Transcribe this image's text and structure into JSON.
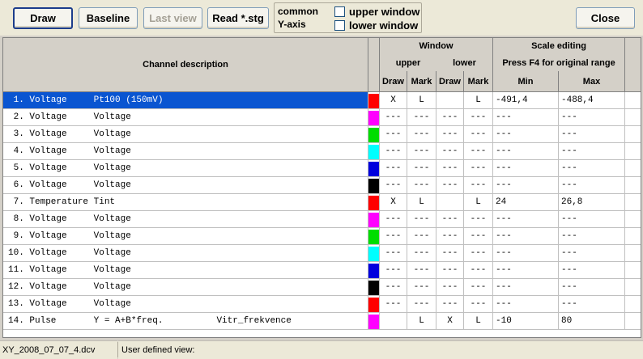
{
  "toolbar": {
    "draw": "Draw",
    "baseline": "Baseline",
    "last_view": "Last view",
    "read_stg": "Read *.stg",
    "axis_line1": "common",
    "axis_line2": "Y-axis",
    "upper_window": "upper window",
    "lower_window": "lower window",
    "close": "Close"
  },
  "headers": {
    "channel_description": "Channel description",
    "window": "Window",
    "upper": "upper",
    "lower": "lower",
    "draw": "Draw",
    "mark": "Mark",
    "scale_editing": "Scale editing",
    "scale_hint": "Press F4 for original range",
    "min": "Min",
    "max": "Max"
  },
  "rows": [
    {
      "desc": " 1. Voltage     Pt100 (150mV)",
      "color": "#ff0000",
      "ud": "X",
      "um": "L",
      "ld": "",
      "lm": "L",
      "min": "-491,4",
      "max": "-488,4"
    },
    {
      "desc": " 2. Voltage     Voltage",
      "color": "#ff00ff",
      "ud": "---",
      "um": "---",
      "ld": "---",
      "lm": "---",
      "min": "---",
      "max": "---"
    },
    {
      "desc": " 3. Voltage     Voltage",
      "color": "#00dd00",
      "ud": "---",
      "um": "---",
      "ld": "---",
      "lm": "---",
      "min": "---",
      "max": "---"
    },
    {
      "desc": " 4. Voltage     Voltage",
      "color": "#00ffff",
      "ud": "---",
      "um": "---",
      "ld": "---",
      "lm": "---",
      "min": "---",
      "max": "---"
    },
    {
      "desc": " 5. Voltage     Voltage",
      "color": "#0000dd",
      "ud": "---",
      "um": "---",
      "ld": "---",
      "lm": "---",
      "min": "---",
      "max": "---"
    },
    {
      "desc": " 6. Voltage     Voltage",
      "color": "#000000",
      "ud": "---",
      "um": "---",
      "ld": "---",
      "lm": "---",
      "min": "---",
      "max": "---"
    },
    {
      "desc": " 7. Temperature Tint",
      "color": "#ff0000",
      "ud": "X",
      "um": "L",
      "ld": "",
      "lm": "L",
      "min": "24",
      "max": "26,8"
    },
    {
      "desc": " 8. Voltage     Voltage",
      "color": "#ff00ff",
      "ud": "---",
      "um": "---",
      "ld": "---",
      "lm": "---",
      "min": "---",
      "max": "---"
    },
    {
      "desc": " 9. Voltage     Voltage",
      "color": "#00dd00",
      "ud": "---",
      "um": "---",
      "ld": "---",
      "lm": "---",
      "min": "---",
      "max": "---"
    },
    {
      "desc": "10. Voltage     Voltage",
      "color": "#00ffff",
      "ud": "---",
      "um": "---",
      "ld": "---",
      "lm": "---",
      "min": "---",
      "max": "---"
    },
    {
      "desc": "11. Voltage     Voltage",
      "color": "#0000dd",
      "ud": "---",
      "um": "---",
      "ld": "---",
      "lm": "---",
      "min": "---",
      "max": "---"
    },
    {
      "desc": "12. Voltage     Voltage",
      "color": "#000000",
      "ud": "---",
      "um": "---",
      "ld": "---",
      "lm": "---",
      "min": "---",
      "max": "---"
    },
    {
      "desc": "13. Voltage     Voltage",
      "color": "#ff0000",
      "ud": "---",
      "um": "---",
      "ld": "---",
      "lm": "---",
      "min": "---",
      "max": "---"
    },
    {
      "desc": "14. Pulse       Y = A+B*freq.          Vitr_frekvence",
      "color": "#ff00ff",
      "ud": "",
      "um": "L",
      "ld": "X",
      "lm": "L",
      "min": "-10",
      "max": "80"
    }
  ],
  "status": {
    "file": "XY_2008_07_07_4.dcv",
    "view": "User defined view:"
  }
}
